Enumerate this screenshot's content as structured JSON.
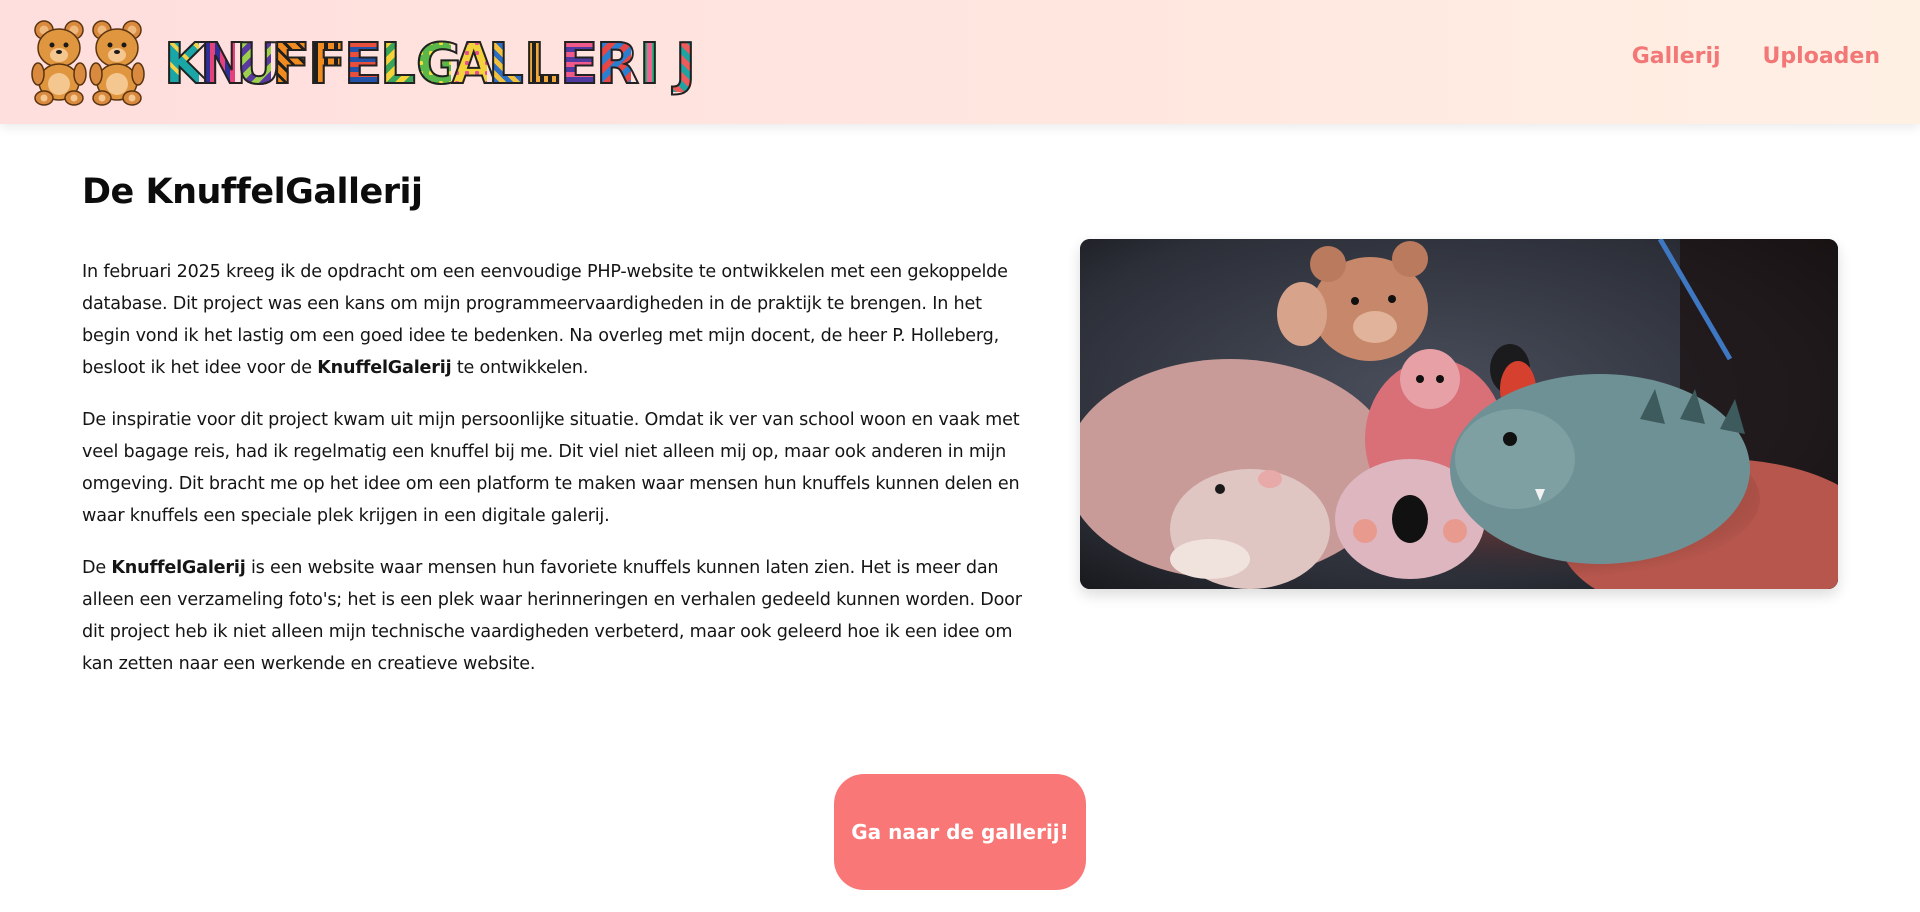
{
  "header": {
    "logo_text": "KNUFFELGALLERIJ",
    "nav": [
      {
        "label": "Gallerij"
      },
      {
        "label": "Uploaden"
      }
    ]
  },
  "main": {
    "title": "De KnuffelGallerij",
    "paragraphs": [
      {
        "a": "In februari 2025 kreeg ik de opdracht om een eenvoudige PHP-website te ontwikkelen met een gekoppelde database. Dit project was een kans om mijn programmeervaardigheden in de praktijk te brengen. In het begin vond ik het lastig om een goed idee te bedenken. Na overleg met mijn docent, de heer P. Holleberg, besloot ik het idee voor de ",
        "bold": "KnuffelGalerij",
        "b": " te ontwikkelen."
      },
      {
        "text": "De inspiratie voor dit project kwam uit mijn persoonlijke situatie. Omdat ik ver van school woon en vaak met veel bagage reis, had ik regelmatig een knuffel bij me. Dit viel niet alleen mij op, maar ook anderen in mijn omgeving. Dit bracht me op het idee om een platform te maken waar mensen hun knuffels kunnen delen en waar knuffels een speciale plek krijgen in een digitale galerij."
      },
      {
        "a": "De ",
        "bold": "KnuffelGalerij",
        "b": " is een website waar mensen hun favoriete knuffels kunnen laten zien. Het is meer dan alleen een verzameling foto's; het is een plek waar herinneringen en verhalen gedeeld kunnen worden. Door dit project heb ik niet alleen mijn technische vaardigheden verbeterd, maar ook geleerd hoe ik een idee om kan zetten naar een werkende en creatieve website."
      }
    ],
    "photo_alt": "Knuffels op een bank",
    "cta_label": "Ga naar de gallerij!"
  },
  "colors": {
    "accent": "#f97777",
    "nav_link": "#f27777",
    "header_gradient_start": "#ffdede",
    "header_gradient_end": "#fff0e4"
  }
}
